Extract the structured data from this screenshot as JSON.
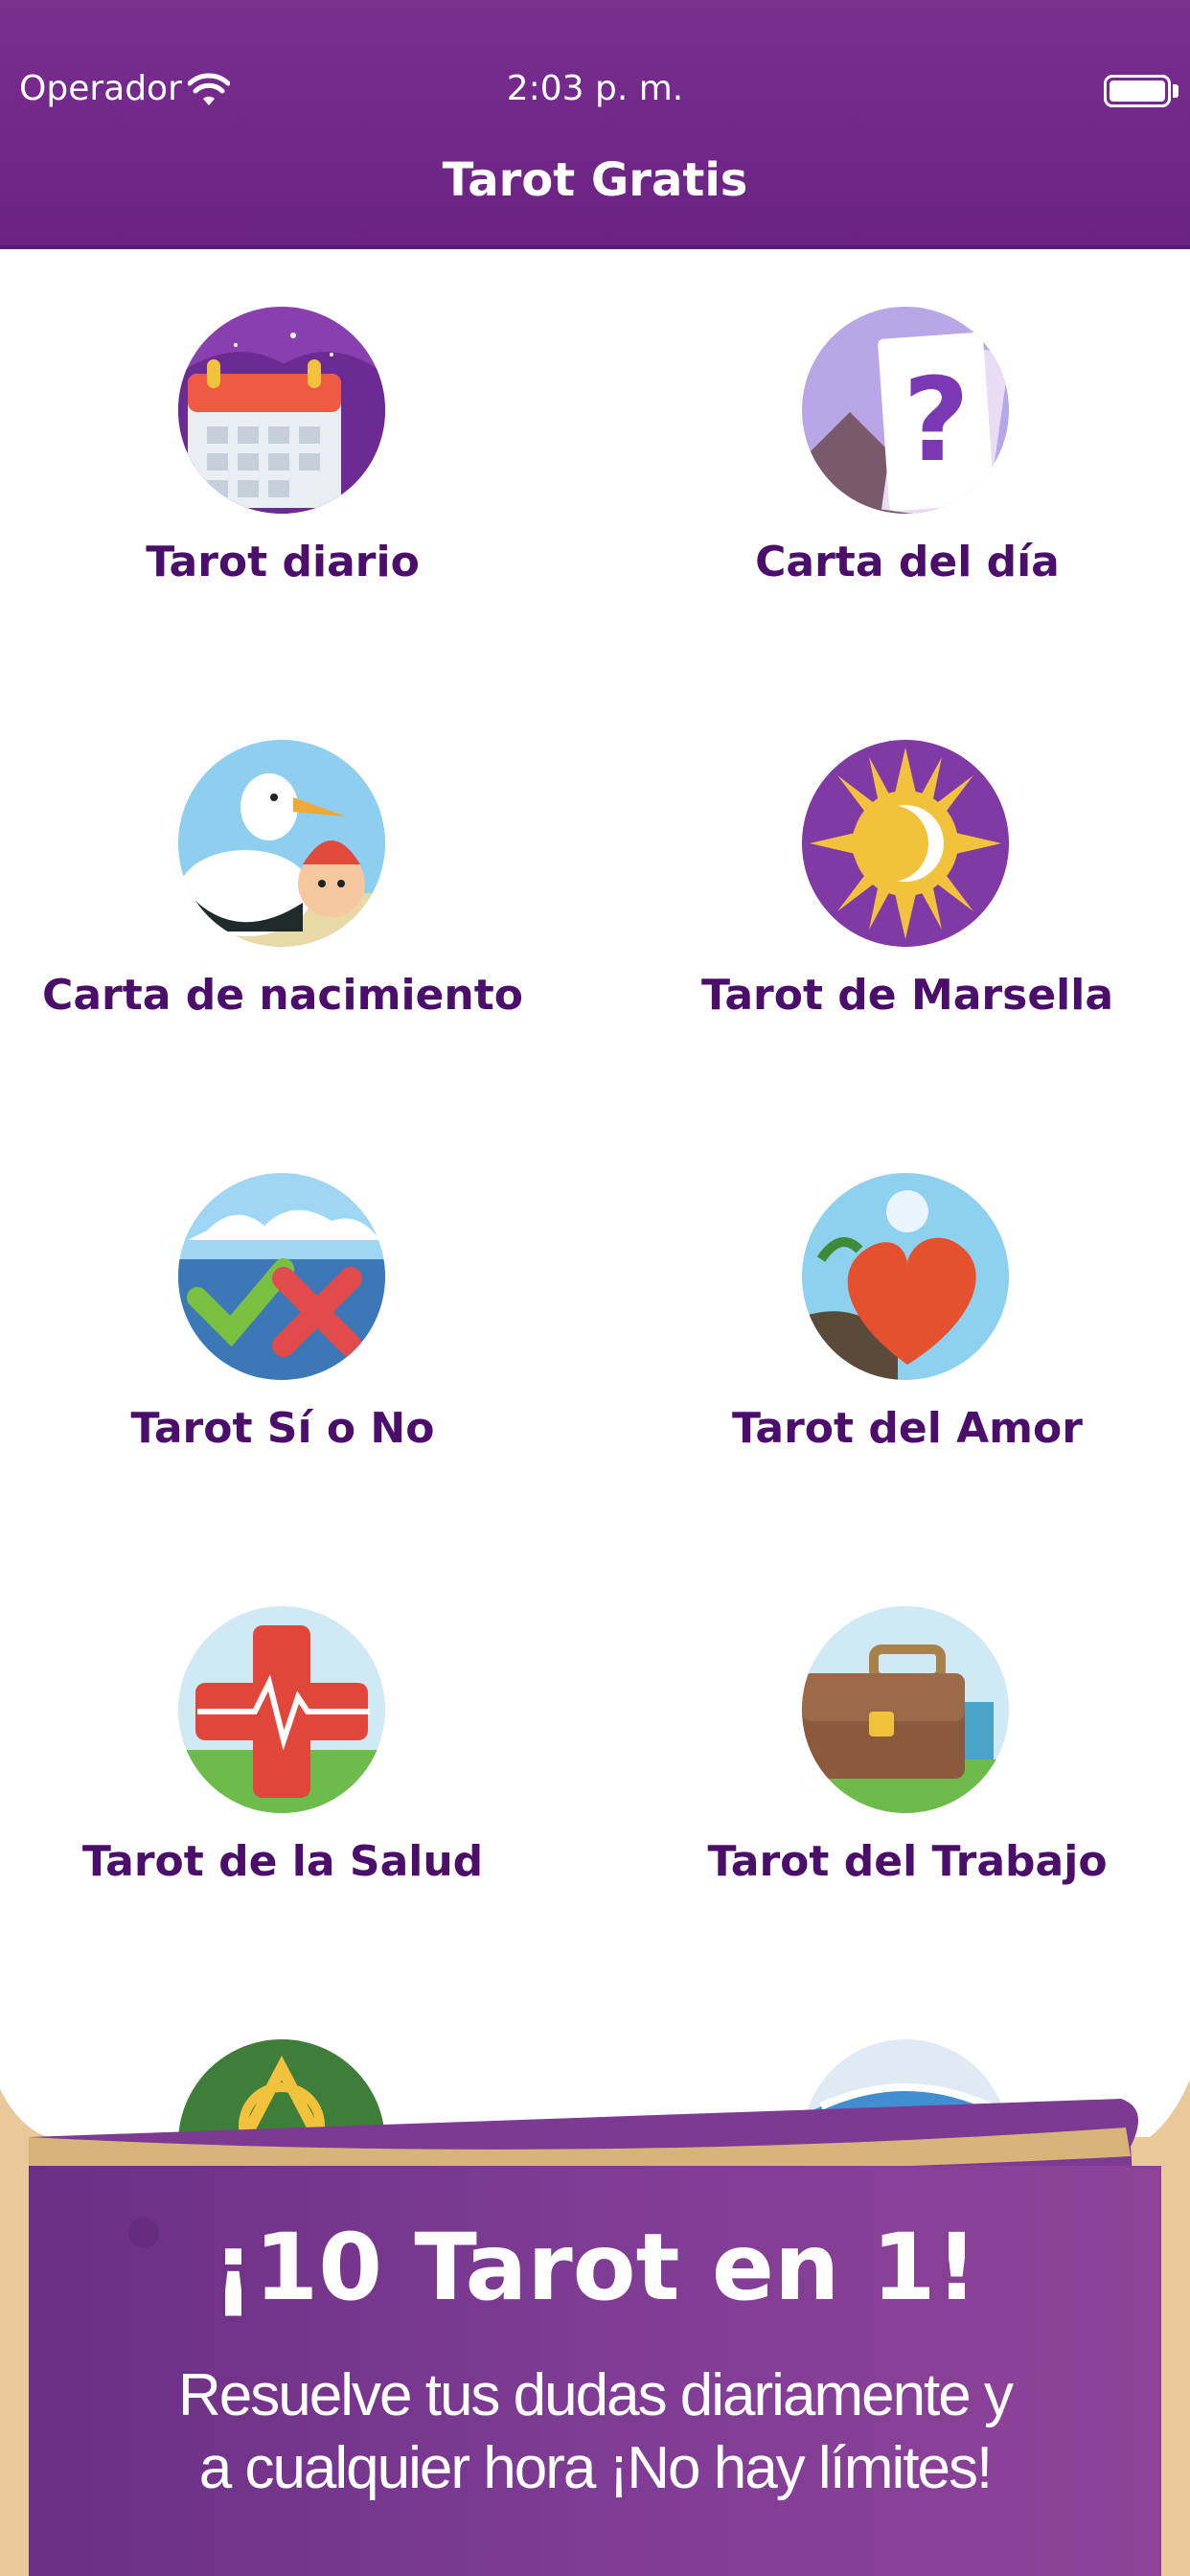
{
  "status_bar": {
    "carrier": "Operador",
    "time": "2:03 p. m."
  },
  "nav": {
    "title": "Tarot Gratis"
  },
  "tiles": [
    {
      "label": "Tarot diario",
      "icon": "calendar-icon"
    },
    {
      "label": "Carta del día",
      "icon": "question-card-icon"
    },
    {
      "label": "Carta de nacimiento",
      "icon": "stork-baby-icon"
    },
    {
      "label": "Tarot de Marsella",
      "icon": "sun-moon-icon"
    },
    {
      "label": "Tarot Sí o No",
      "icon": "check-cross-icon"
    },
    {
      "label": "Tarot del Amor",
      "icon": "heart-icon"
    },
    {
      "label": "Tarot de la Salud",
      "icon": "health-cross-icon"
    },
    {
      "label": "Tarot del Trabajo",
      "icon": "briefcase-icon"
    },
    {
      "icon": "celtic-knot-icon"
    },
    {
      "icon": "eye-icon"
    }
  ],
  "banner": {
    "headline": "¡10 Tarot en 1!",
    "subline_1": "Resuelve tus dudas diariamente y",
    "subline_2": "a cualquier hora ¡No hay límites!"
  },
  "colors": {
    "header": "#6a2283",
    "label": "#4b0f6b",
    "banner": "#7d3a93"
  }
}
